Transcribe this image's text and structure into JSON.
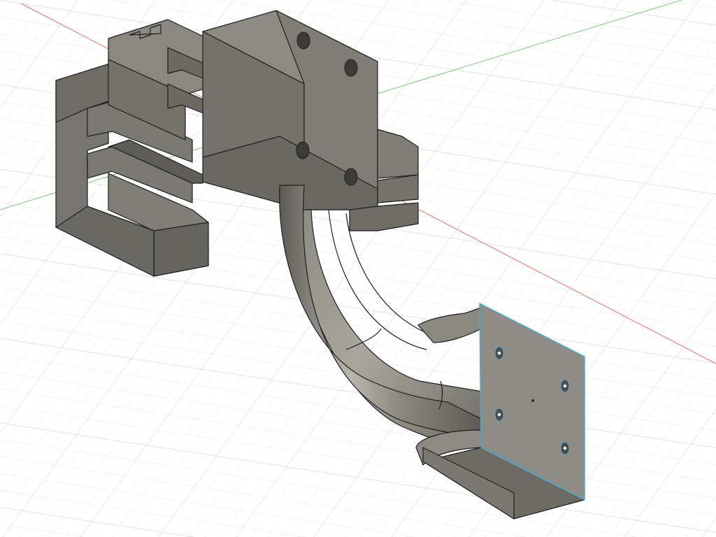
{
  "viewport": {
    "view": "3d-model-canvas",
    "background_color": "#ffffff",
    "grid": {
      "visible": true,
      "minor_color": "#e6e6e6",
      "major_color": "#cfcfcf"
    },
    "axes": {
      "x_axis_color": "#e07070",
      "y_axis_color": "#78c878"
    },
    "model": {
      "body_color": "#7c7a72",
      "highlight_color": "#9f9c93",
      "shadow_color": "#5f5d57",
      "edge_color": "#1e1e1e",
      "selected_face": {
        "fill_color": "#8e8c84",
        "outline_color": "#4aa8d8",
        "hole_count": 4
      }
    }
  }
}
